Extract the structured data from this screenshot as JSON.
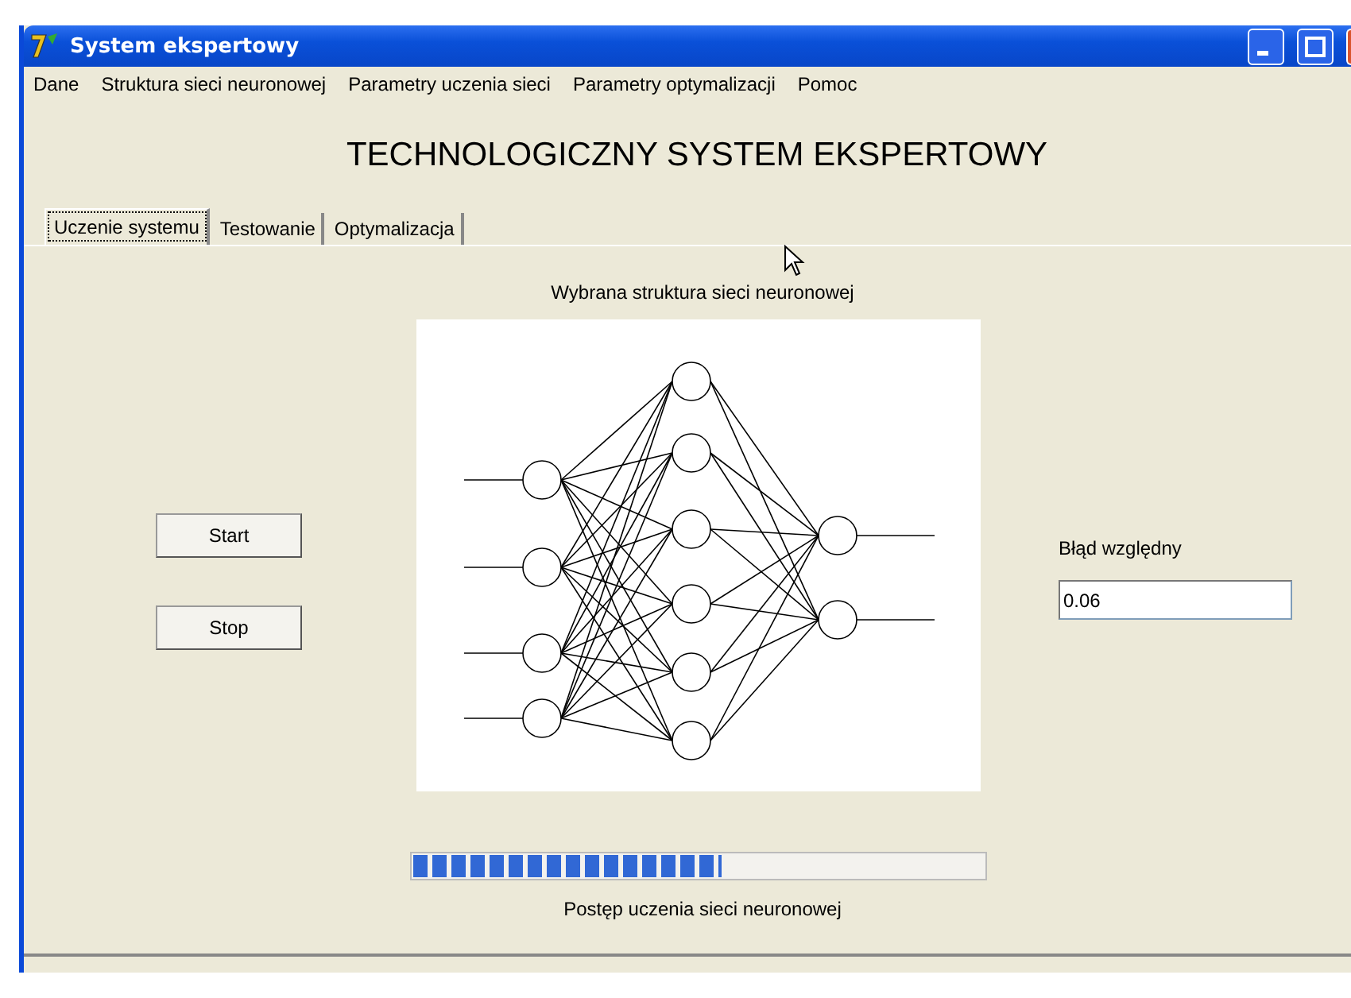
{
  "window": {
    "title": "System ekspertowy"
  },
  "menu": [
    "Dane",
    "Struktura sieci neuronowej",
    "Parametry uczenia sieci",
    "Parametry optymalizacji",
    "Pomoc"
  ],
  "heading": "TECHNOLOGICZNY SYSTEM EKSPERTOWY",
  "tabs": [
    {
      "label": "Uczenie systemu",
      "selected": true
    },
    {
      "label": "Testowanie",
      "selected": false
    },
    {
      "label": "Optymalizacja",
      "selected": false
    }
  ],
  "diagram_caption": "Wybrana struktura sieci neuronowej",
  "buttons": [
    "Start",
    "Stop"
  ],
  "error": {
    "label": "Błąd względny",
    "value": "0.06"
  },
  "progress": {
    "level": 0.54,
    "caption": "Postęp uczenia sieci neuronowej"
  }
}
